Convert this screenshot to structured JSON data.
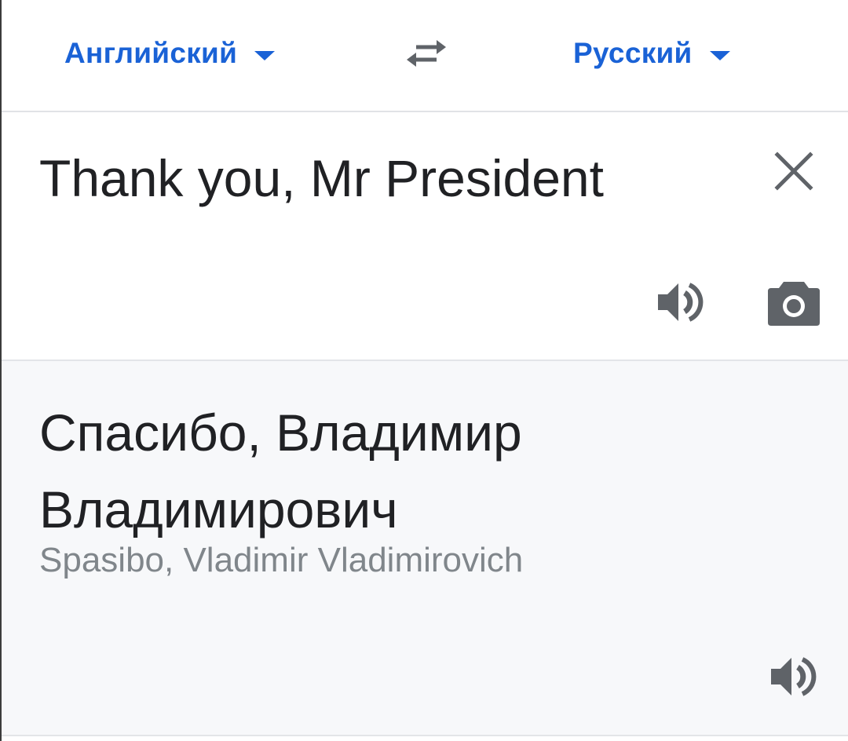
{
  "language_bar": {
    "source_language": "Английский",
    "target_language": "Русский",
    "swap_icon": "swap-arrows-icon",
    "caret_icon": "caret-down-icon",
    "accent_color": "#1a62d6"
  },
  "input": {
    "source_text": "Thank you, Mr President",
    "clear_icon": "close-icon",
    "listen_icon": "speaker-icon",
    "camera_icon": "camera-icon"
  },
  "result": {
    "translation": "Спасибо, Владимир Владимирович",
    "transliteration": "Spasibo, Vladimir Vladimirovich",
    "listen_icon": "speaker-icon"
  }
}
